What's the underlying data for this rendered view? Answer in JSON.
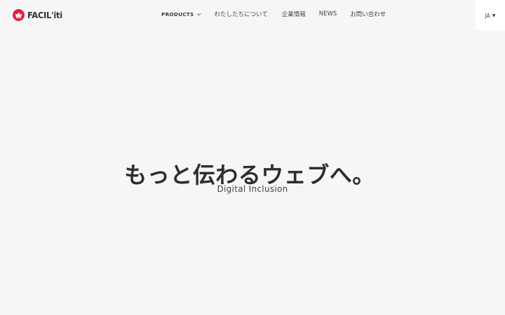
{
  "brand": {
    "name": "FACIL'iti",
    "accent": "#d9243f"
  },
  "nav": {
    "items": [
      {
        "label": "PRODUCTS"
      },
      {
        "label": "わたしたちについて"
      },
      {
        "label": "企業情報"
      },
      {
        "label": "NEWS"
      },
      {
        "label": "お問い合わせ"
      }
    ],
    "language": "JA"
  },
  "hero": {
    "title": "もっと伝わるウェブへ。",
    "subtitle": "Digital Inclusion"
  },
  "icons": {
    "logo": "crown-logo-icon",
    "products_dropdown": "chevron-down-icon",
    "language_dropdown": "caret-down-icon"
  }
}
